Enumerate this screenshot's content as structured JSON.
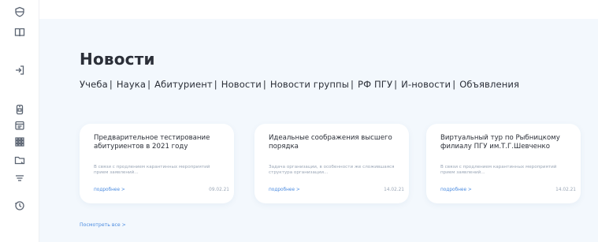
{
  "sidebar": {
    "icons": [
      "shield-icon",
      "book-icon",
      "login-icon",
      "phone-icon",
      "calendar-icon",
      "grid-icon",
      "folder-icon",
      "filter-icon",
      "clock-icon"
    ]
  },
  "page": {
    "title": "Новости"
  },
  "tabs": [
    {
      "label": "Учеба"
    },
    {
      "label": "Наука"
    },
    {
      "label": "Абитуриент"
    },
    {
      "label": "Новости"
    },
    {
      "label": "Новости группы"
    },
    {
      "label": "РФ ПГУ"
    },
    {
      "label": "И-новости"
    },
    {
      "label": "Объявления"
    }
  ],
  "tab_separator": "|",
  "cards": [
    {
      "title": "Предварительное тестирование абитуриентов в 2021 году",
      "text": "В связи с продлением карантинных мероприятий прием заявлений...",
      "more": "подробнее >",
      "date": "09.02.21"
    },
    {
      "title": "Идеальные соображения высшего порядка",
      "text": "Задача организации, в особенности же сложившаяся структура организации...",
      "more": "подробнее >",
      "date": "14.02.21"
    },
    {
      "title": "Виртуальный тур по Рыбницкому филиалу ПГУ им.Т.Г.Шевченко",
      "text": "В связи с продлением карантинных мероприятий прием заявлений...",
      "more": "подробнее >",
      "date": "14.02.21"
    }
  ],
  "see_all": "Посмотреть все >",
  "colors": {
    "background": "#f3f8fd",
    "link": "#4a8be0",
    "text": "#2b2f38",
    "muted": "#9aa6b6"
  }
}
